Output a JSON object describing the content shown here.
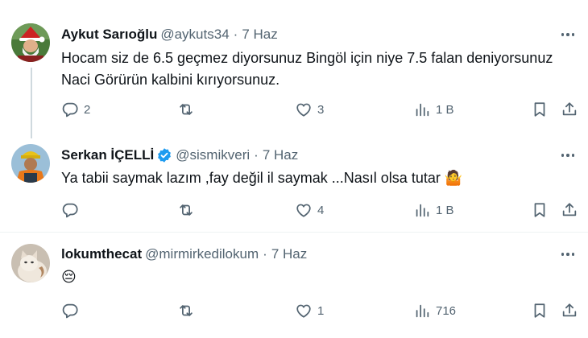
{
  "tweets": [
    {
      "name": "Aykut Sarıoğlu",
      "handle": "@aykuts34",
      "sep": "·",
      "time": "7 Haz",
      "text": "Hocam siz de 6.5 geçmez diyorsunuz Bingöl için niye 7.5 falan deniyorsunuz Naci Görürün kalbini kırıyorsunuz.",
      "replies": "2",
      "retweets": "",
      "likes": "3",
      "views": "1 B",
      "verified": false
    },
    {
      "name": "Serkan İÇELLİ",
      "handle": "@sismikveri",
      "sep": "·",
      "time": "7 Haz",
      "text": "Ya tabii saymak lazım ,fay değil il saymak ...Nasıl olsa tutar 🤷",
      "replies": "",
      "retweets": "",
      "likes": "4",
      "views": "1 B",
      "verified": true
    },
    {
      "name": "lokumthecat",
      "handle": "@mirmirkedilokum",
      "sep": "·",
      "time": "7 Haz",
      "text": "😔",
      "replies": "",
      "retweets": "",
      "likes": "1",
      "views": "716",
      "verified": false
    }
  ],
  "icons": {
    "reply": "reply-icon",
    "retweet": "retweet-icon",
    "like": "heart-icon",
    "views": "views-chart-icon",
    "bookmark": "bookmark-icon",
    "share": "share-icon",
    "more": "more-dots-icon",
    "verified": "verified-badge-icon"
  },
  "colors": {
    "text": "#0f1419",
    "secondary": "#536471",
    "verified": "#1d9bf0",
    "thread_line": "#cfd9de"
  }
}
